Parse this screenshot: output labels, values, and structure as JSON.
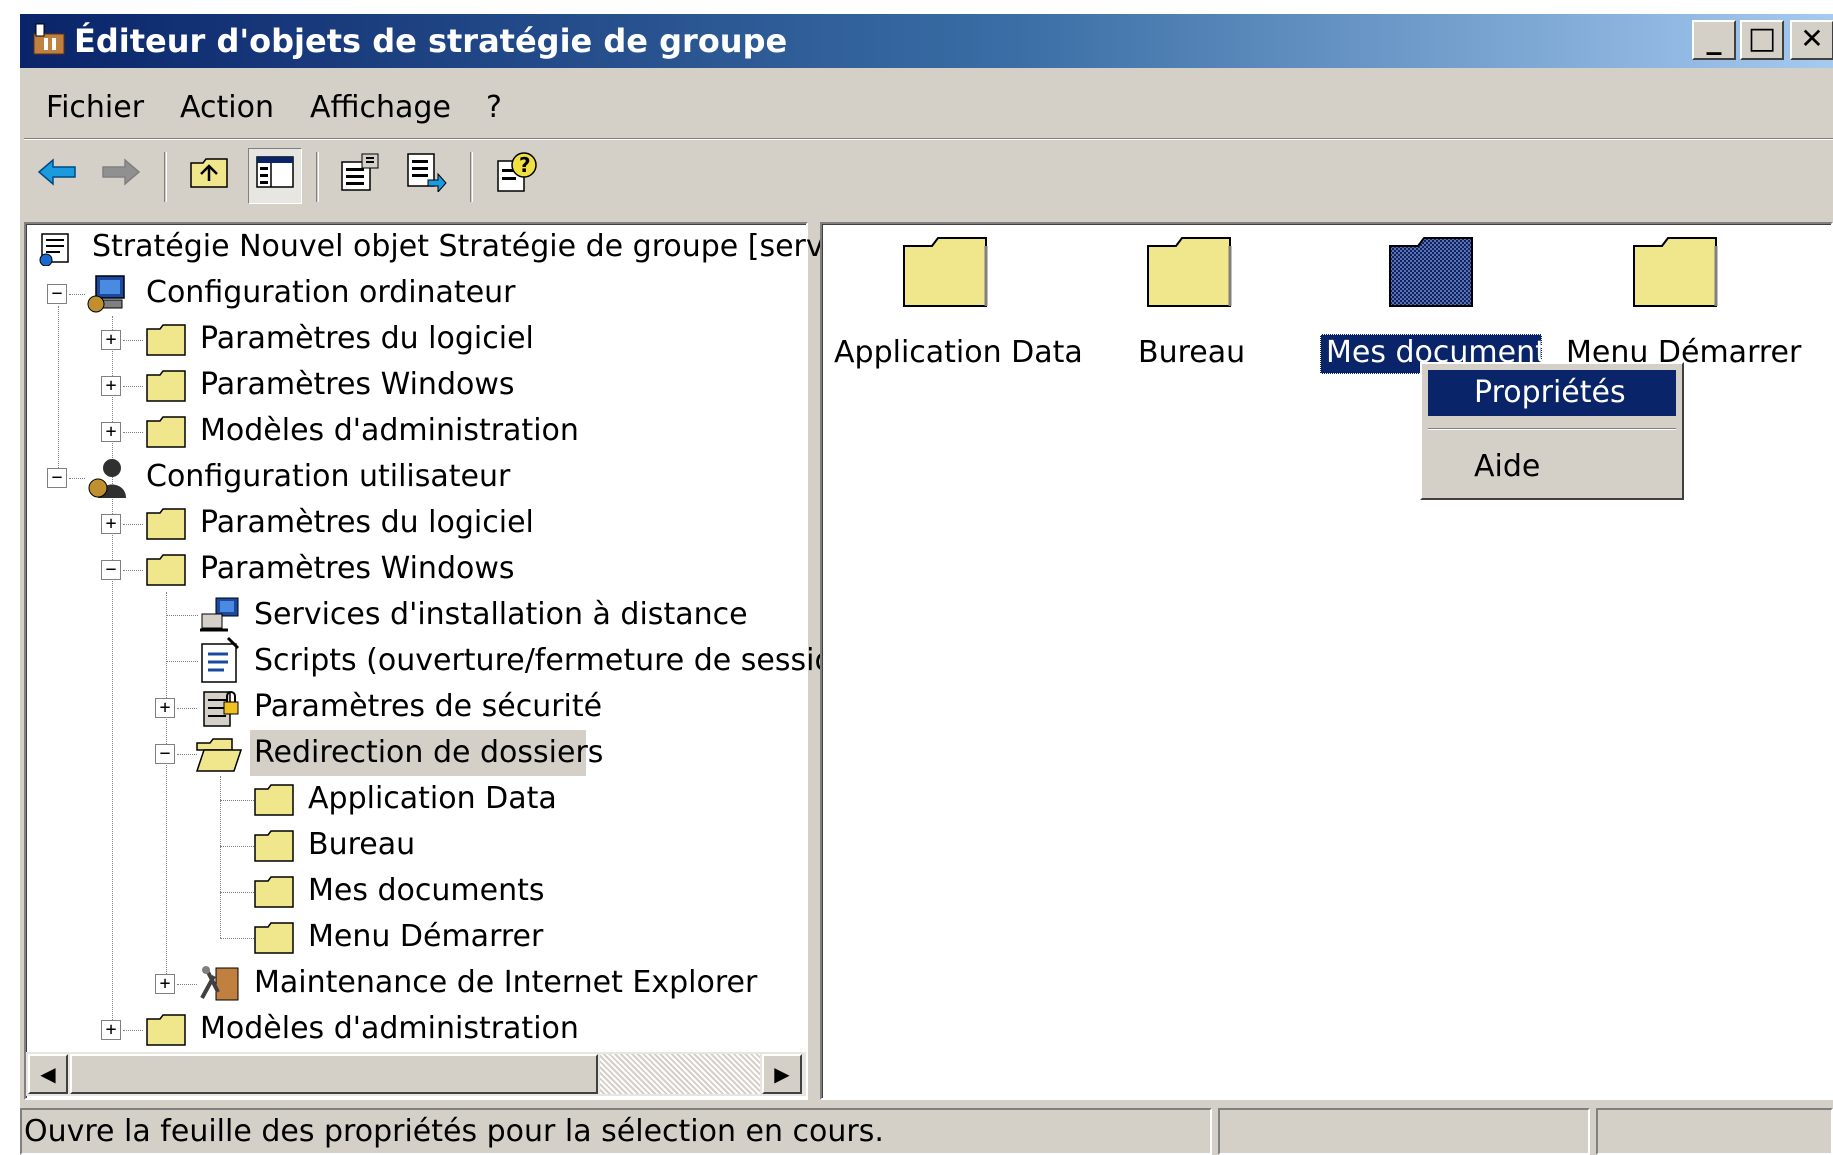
{
  "window": {
    "title": "Éditeur d'objets de stratégie de groupe",
    "minimize": "_",
    "maximize": "□",
    "close": "✕"
  },
  "menu": {
    "file": "Fichier",
    "action": "Action",
    "view": "Affichage",
    "help": "?"
  },
  "toolbar": {
    "icons": [
      "back-arrow-icon",
      "forward-arrow-icon",
      "up-folder-icon",
      "show-hide-tree-icon",
      "properties-icon",
      "export-list-icon",
      "help-icon"
    ]
  },
  "tree": {
    "root": "Stratégie Nouvel objet Stratégie de groupe [serveur",
    "computer_config": "Configuration ordinateur",
    "cc_software": "Paramètres du logiciel",
    "cc_windows": "Paramètres Windows",
    "cc_admin": "Modèles d'administration",
    "user_config": "Configuration utilisateur",
    "uc_software": "Paramètres du logiciel",
    "uc_windows": "Paramètres Windows",
    "ris": "Services d'installation à distance",
    "scripts": "Scripts (ouverture/fermeture de session",
    "security": "Paramètres de sécurité",
    "folder_redirection": "Redirection de dossiers",
    "fr_appdata": "Application Data",
    "fr_desktop": "Bureau",
    "fr_mydocs": "Mes documents",
    "fr_startmenu": "Menu Démarrer",
    "ie_maintenance": "Maintenance de Internet Explorer",
    "uc_admin": "Modèles d'administration"
  },
  "content": {
    "items": [
      "Application Data",
      "Bureau",
      "Mes documents",
      "Menu Démarrer"
    ]
  },
  "context_menu": {
    "properties": "Propriétés",
    "help": "Aide"
  },
  "status": {
    "text": "Ouvre la feuille des propriétés pour la sélection en cours."
  },
  "colors": {
    "title_active": "#0a246a",
    "face": "#d4d0c8",
    "folder_yellow": "#f0e68c",
    "selection": "#0a246a"
  }
}
